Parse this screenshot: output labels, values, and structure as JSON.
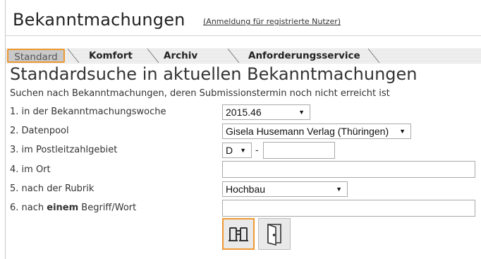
{
  "header": {
    "title": "Bekanntmachungen",
    "login_link": "(Anmeldung für registrierte Nutzer)"
  },
  "tabs": [
    {
      "label": "Standard",
      "active": true
    },
    {
      "label": "Komfort",
      "active": false
    },
    {
      "label": "Archiv",
      "active": false
    },
    {
      "label": "Anforderungsservice",
      "active": false
    }
  ],
  "main": {
    "heading": "Standardsuche in aktuellen Bekanntmachungen",
    "subtitle": "Suchen nach Bekanntmachungen, deren Submissionstermin noch nicht erreicht ist"
  },
  "form": {
    "week_label": "1. in der Bekanntmachungswoche",
    "week_value": "2015.46",
    "pool_label": "2. Datenpool",
    "pool_value": "Gisela Husemann Verlag (Thüringen)",
    "plz_label": "3. im Postleitzahlgebiet",
    "plz_country": "D",
    "plz_separator": "-",
    "plz_value": "",
    "ort_label": "4. im Ort",
    "ort_value": "",
    "rubrik_label": "5. nach der Rubrik",
    "rubrik_value": "Hochbau",
    "term_label_prefix": "6. nach ",
    "term_label_bold": "einem",
    "term_label_suffix": " Begriff/Wort",
    "term_value": ""
  },
  "buttons": {
    "search_icon": "binoculars-icon",
    "exit_icon": "door-icon"
  },
  "colors": {
    "accent": "#ee9933"
  }
}
